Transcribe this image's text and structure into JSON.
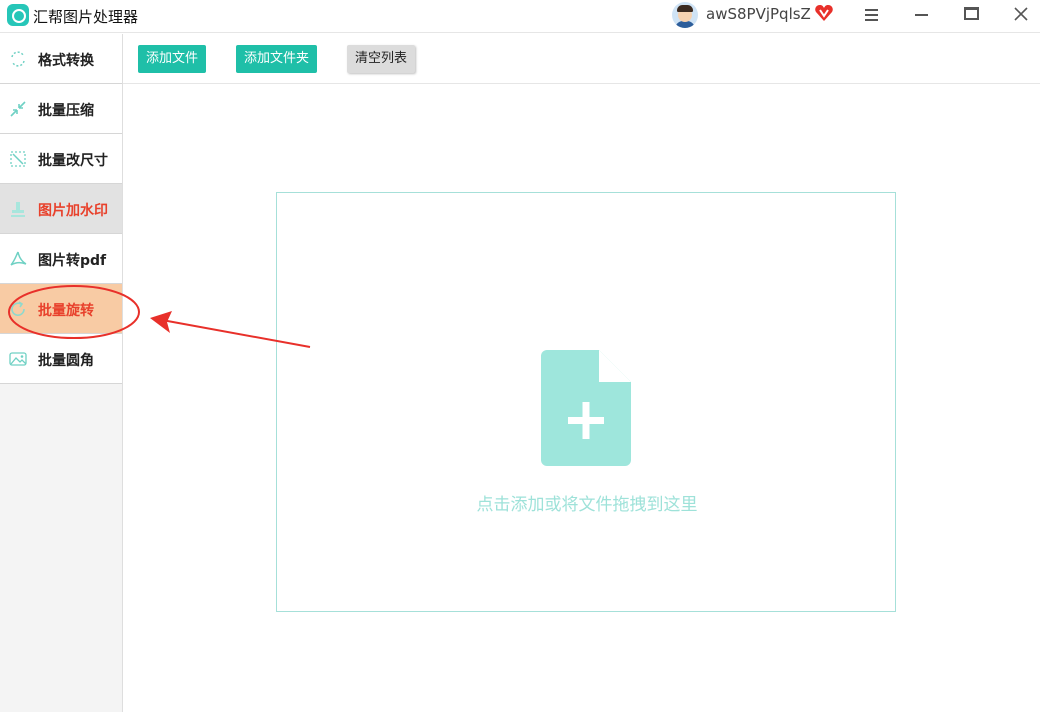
{
  "app": {
    "title": "汇帮图片处理器",
    "username": "awS8PVjPqlsZ",
    "accent_color": "#1fbfa8"
  },
  "sidebar": {
    "items": [
      {
        "label": "格式转换",
        "icon": "format-convert-icon",
        "state": "normal"
      },
      {
        "label": "批量压缩",
        "icon": "compress-icon",
        "state": "normal"
      },
      {
        "label": "批量改尺寸",
        "icon": "resize-icon",
        "state": "normal"
      },
      {
        "label": "图片加水印",
        "icon": "watermark-icon",
        "state": "active"
      },
      {
        "label": "图片转pdf",
        "icon": "pdf-icon",
        "state": "normal"
      },
      {
        "label": "批量旋转",
        "icon": "rotate-icon",
        "state": "highlighted"
      },
      {
        "label": "批量圆角",
        "icon": "round-corner-icon",
        "state": "normal"
      }
    ]
  },
  "toolbar": {
    "add_file_label": "添加文件",
    "add_folder_label": "添加文件夹",
    "clear_list_label": "清空列表"
  },
  "dropzone": {
    "hint": "点击添加或将文件拖拽到这里",
    "icon": "file-add-icon"
  },
  "annotation": {
    "color": "#e8302a",
    "shapes": [
      "ellipse",
      "arrow"
    ]
  }
}
